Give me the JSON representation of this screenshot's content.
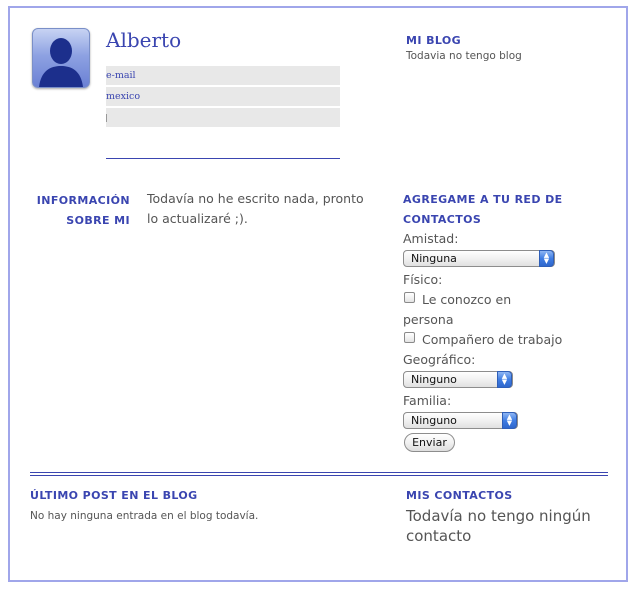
{
  "profile": {
    "name": "Alberto",
    "rows": [
      "e-mail",
      "mexico",
      ""
    ]
  },
  "blog": {
    "heading": "MI BLOG",
    "text": "Todavia no tengo blog"
  },
  "about": {
    "heading_line1": "INFORMACIÓN",
    "heading_line2": "SOBRE MI",
    "text_line1": "Todavía no he escrito nada, pronto",
    "text_line2": "lo actualizaré ;)."
  },
  "network": {
    "heading_line1": "AGREGAME A TU RED DE",
    "heading_line2": "CONTACTOS",
    "amistad_label": "Amistad:",
    "amistad_value": "Ninguna",
    "fisico_label": "Físico:",
    "check1_line1": "Le conozco en",
    "check1_line2": "persona",
    "check2_label": "Compañero de trabajo",
    "geografico_label": "Geográfico:",
    "geografico_value": "Ninguno",
    "familia_label": "Familia:",
    "familia_value": "Ninguno",
    "submit_label": "Enviar"
  },
  "last_post": {
    "heading": "ÚLTIMO POST EN EL BLOG",
    "text": "No hay ninguna entrada en el blog todavía."
  },
  "contacts": {
    "heading": "MIS CONTACTOS",
    "text_line1": "Todavía no tengo ningún",
    "text_line2": "contacto"
  },
  "colors": {
    "accent": "#3a45b0",
    "frame_border": "#a0a6ea",
    "text": "#555555"
  }
}
